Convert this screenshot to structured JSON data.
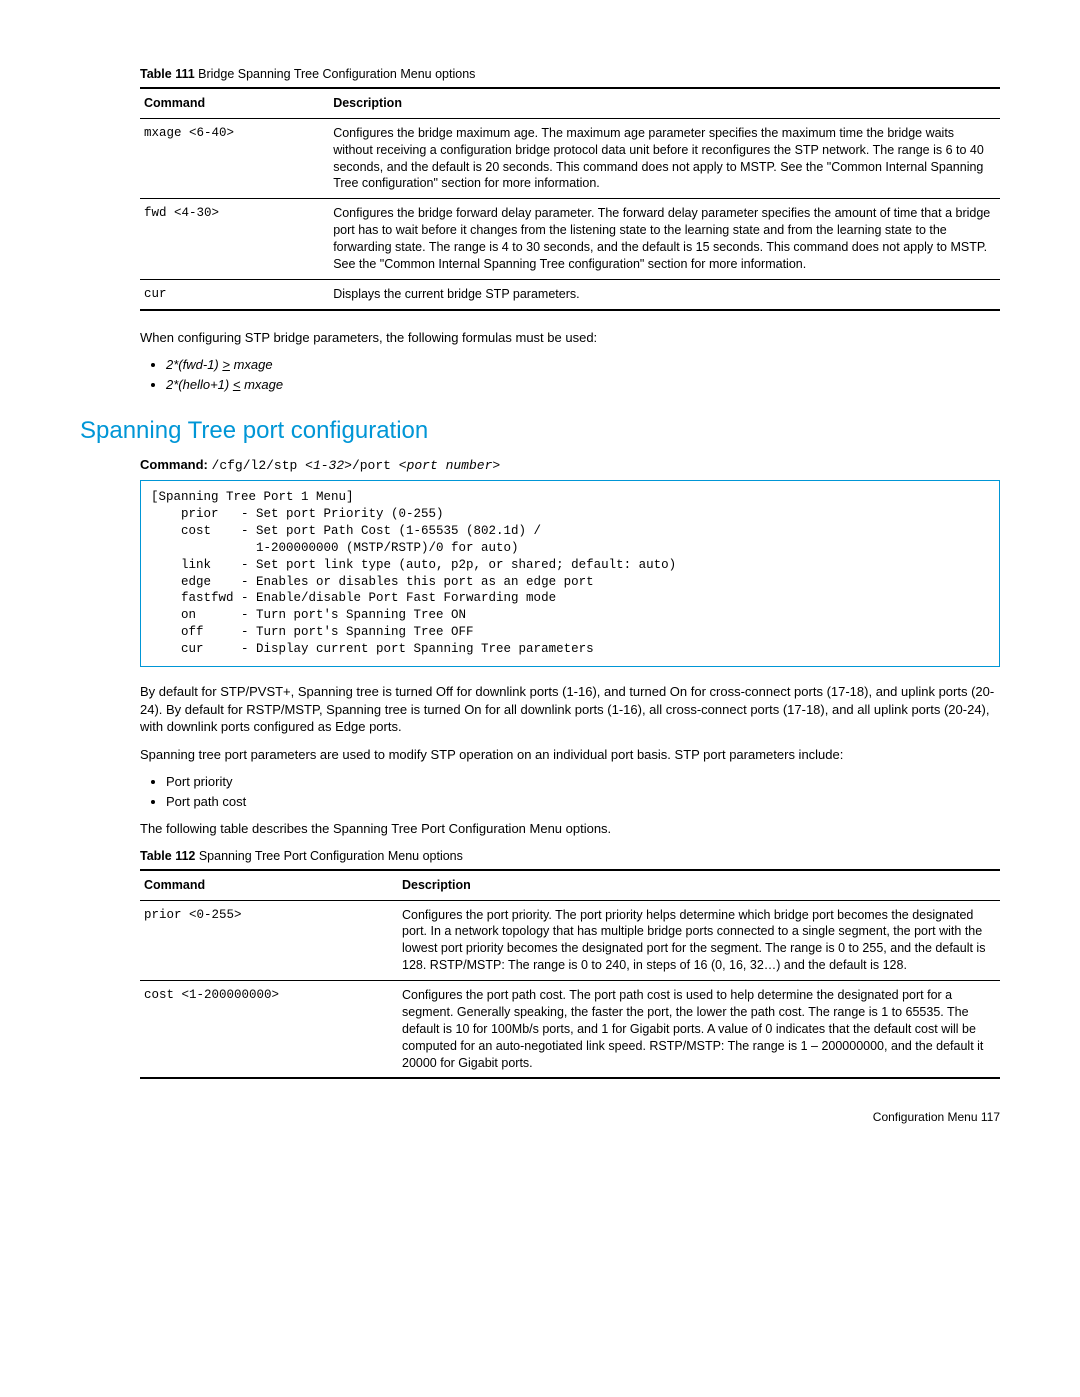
{
  "table111": {
    "caption_label": "Table 111",
    "caption_text": " Bridge Spanning Tree Configuration Menu options",
    "col1": "Command",
    "col2": "Description",
    "rows": [
      {
        "cmd": "mxage <6-40>",
        "desc": "Configures the bridge maximum age. The maximum age parameter specifies the maximum time the bridge waits without receiving a configuration bridge protocol data unit before it reconfigures the STP network. The range is 6 to 40 seconds, and the default is 20 seconds. This command does not apply to MSTP. See the \"Common Internal Spanning Tree configuration\" section for more information."
      },
      {
        "cmd": "fwd <4-30>",
        "desc": "Configures the bridge forward delay parameter. The forward delay parameter specifies the amount of time that a bridge port has to wait before it changes from the listening state to the learning state and from the learning state to the forwarding state. The range is 4 to 30 seconds, and the default is 15 seconds. This command does not apply to MSTP. See the \"Common Internal Spanning Tree configuration\" section for more information."
      },
      {
        "cmd": "cur",
        "desc": "Displays the current bridge STP parameters."
      }
    ]
  },
  "intro_after_t111": "When configuring STP bridge parameters, the following formulas must be used:",
  "formulas": [
    "2*(fwd-1) > mxage",
    "2*(hello+1) < mxage"
  ],
  "section_title": "Spanning Tree port configuration",
  "cmdline_label": "Command:",
  "cmdline_text_prefix": "/cfg/l2/stp ",
  "cmdline_arg1": "<1-32>",
  "cmdline_text_mid": "/port ",
  "cmdline_arg2": "<port number>",
  "menubox": "[Spanning Tree Port 1 Menu]\n    prior   - Set port Priority (0-255)\n    cost    - Set port Path Cost (1-65535 (802.1d) /\n              1-200000000 (MSTP/RSTP)/0 for auto)\n    link    - Set port link type (auto, p2p, or shared; default: auto)\n    edge    - Enables or disables this port as an edge port\n    fastfwd - Enable/disable Port Fast Forwarding mode\n    on      - Turn port's Spanning Tree ON\n    off     - Turn port's Spanning Tree OFF\n    cur     - Display current port Spanning Tree parameters",
  "para1": "By default for STP/PVST+, Spanning tree is turned Off for downlink ports (1-16), and turned On for cross-connect ports (17-18), and uplink ports (20-24). By default for RSTP/MSTP, Spanning tree is turned On for all downlink ports (1-16), all cross-connect ports (17-18), and all uplink ports (20-24), with downlink ports configured as Edge ports.",
  "para2": "Spanning tree port parameters are used to modify STP operation on an individual port basis. STP port parameters include:",
  "param_bullets": [
    "Port priority",
    "Port path cost"
  ],
  "para3": "The following table describes the Spanning Tree Port Configuration Menu options.",
  "table112": {
    "caption_label": "Table 112",
    "caption_text": " Spanning Tree Port Configuration Menu options",
    "col1": "Command",
    "col2": "Description",
    "rows": [
      {
        "cmd": "prior <0-255>",
        "desc": "Configures the port priority. The port priority helps determine which bridge port becomes the designated port. In a network topology that has multiple bridge ports connected to a single segment, the port with the lowest port priority becomes the designated port for the segment. The range is 0 to 255, and the default is 128. RSTP/MSTP: The range is 0 to 240, in steps of 16 (0, 16, 32…) and the default is 128."
      },
      {
        "cmd": "cost <1-200000000>",
        "desc": "Configures the port path cost. The port path cost is used to help determine the designated port for a segment. Generally speaking, the faster the port, the lower the path cost. The range is 1 to 65535. The default is 10 for 100Mb/s ports, and 1 for Gigabit ports. A value of 0 indicates that the default cost will be computed for an auto-negotiated link speed. RSTP/MSTP: The range is 1 – 200000000, and the default it 20000 for Gigabit ports."
      }
    ]
  },
  "footer": "Configuration Menu   117"
}
